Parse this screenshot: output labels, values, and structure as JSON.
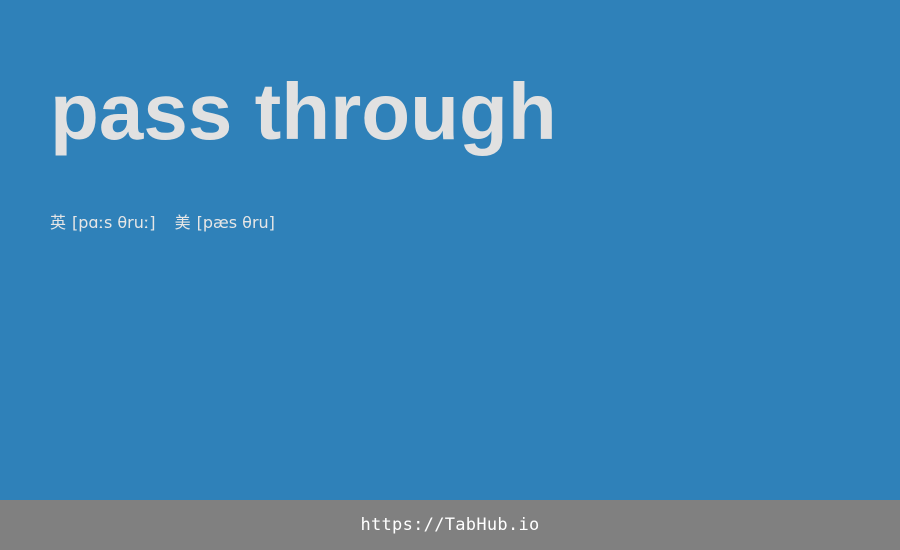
{
  "word": "pass through",
  "phonetics": {
    "uk_label": "英",
    "uk_ipa": "[pɑːs θruː]",
    "us_label": "美",
    "us_ipa": "[pæs θru]"
  },
  "footer": {
    "url_text": "https://TabHub.io"
  },
  "colors": {
    "background": "#2f81b9",
    "word_text": "#e1e1e1",
    "footer_background": "#808080",
    "footer_text": "#ffffff"
  }
}
